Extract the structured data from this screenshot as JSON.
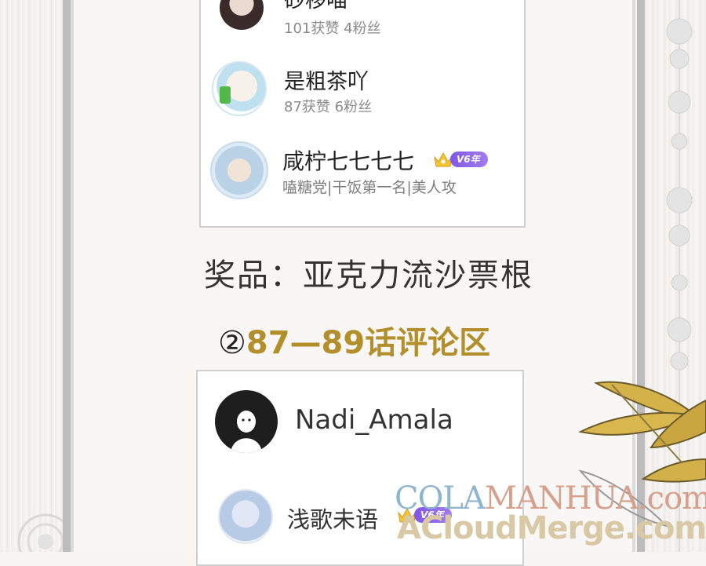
{
  "top_card": {
    "users": [
      {
        "name": "砂移喵",
        "stats": "101获赞 4粉丝"
      },
      {
        "name": "是粗茶吖",
        "stats": "87获赞 6粉丝"
      },
      {
        "name": "咸柠七七七七",
        "stats": "嗑糖党|干饭第一名|美人攻",
        "badge": "V6年"
      }
    ]
  },
  "prize_text": "奖品：亚克力流沙票根",
  "section": {
    "circle": "②",
    "title": "87—89话评论区"
  },
  "bottom_card": {
    "users": [
      {
        "name": "Nadi_Amala"
      },
      {
        "name": "浅歌未语",
        "badge": "V6年"
      }
    ]
  },
  "watermark": {
    "line1_a": "COLA",
    "line1_b": "MANHUA.com",
    "line2": "ACloudMerge.com"
  },
  "colors": {
    "gold": "#b38f2b",
    "badge_purple": "#8b63ea"
  }
}
